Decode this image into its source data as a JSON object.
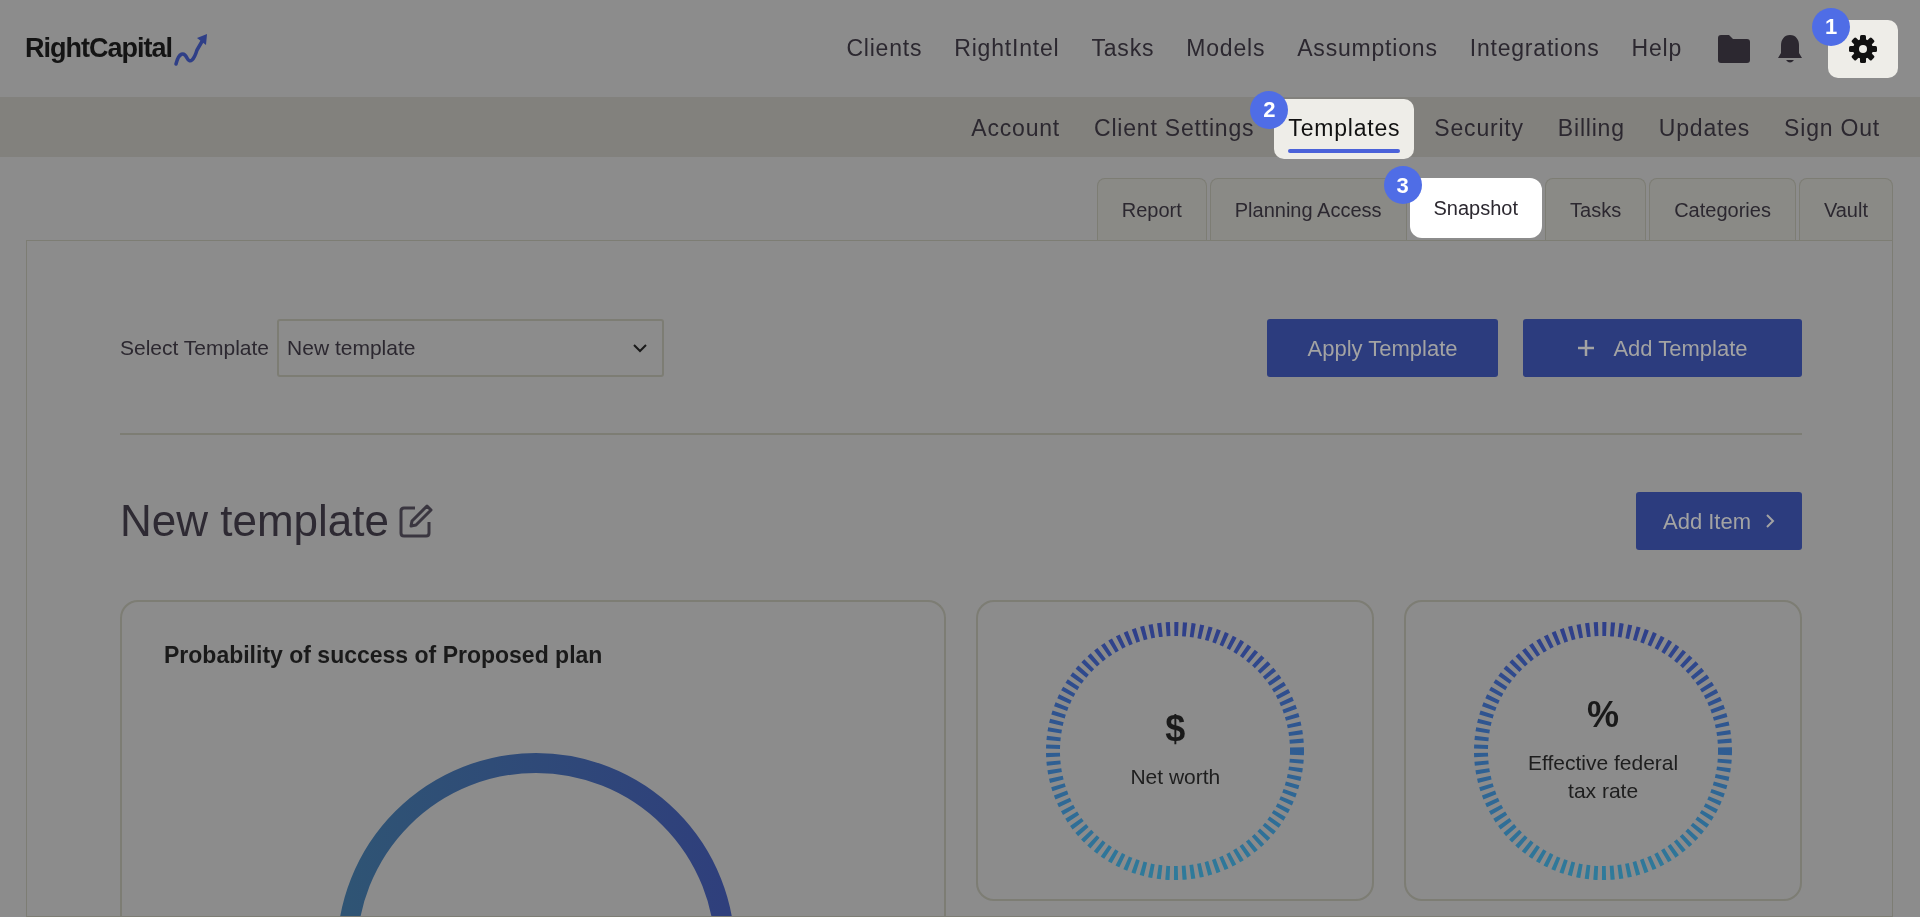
{
  "logo": {
    "text": "RightCapital"
  },
  "main_nav": [
    {
      "label": "Clients"
    },
    {
      "label": "RightIntel"
    },
    {
      "label": "Tasks"
    },
    {
      "label": "Models"
    },
    {
      "label": "Assumptions"
    },
    {
      "label": "Integrations"
    },
    {
      "label": "Help"
    }
  ],
  "settings_button": {
    "highlighted": true,
    "step_badge": "1"
  },
  "sub_nav": [
    {
      "label": "Account",
      "selected": false
    },
    {
      "label": "Client Settings",
      "selected": false
    },
    {
      "label": "Templates",
      "selected": true,
      "step_badge": "2"
    },
    {
      "label": "Security",
      "selected": false
    },
    {
      "label": "Billing",
      "selected": false
    },
    {
      "label": "Updates",
      "selected": false
    },
    {
      "label": "Sign Out",
      "selected": false
    }
  ],
  "tabs": [
    {
      "label": "Report",
      "selected": false
    },
    {
      "label": "Planning Access",
      "selected": false
    },
    {
      "label": "Snapshot",
      "selected": true,
      "step_badge": "3"
    },
    {
      "label": "Tasks",
      "selected": false
    },
    {
      "label": "Categories",
      "selected": false
    },
    {
      "label": "Vault",
      "selected": false
    }
  ],
  "template_select": {
    "label": "Select Template",
    "value": "New template"
  },
  "apply_button": "Apply Template",
  "add_template_button": "Add Template",
  "heading": "New template",
  "add_item_button": "Add Item",
  "cards": [
    {
      "kind": "ring",
      "title": "Probability of success of Proposed plan"
    },
    {
      "kind": "dashed-ring",
      "symbol": "$",
      "label": "Net worth"
    },
    {
      "kind": "dashed-ring",
      "symbol": "%",
      "label": "Effective federal tax rate"
    }
  ]
}
